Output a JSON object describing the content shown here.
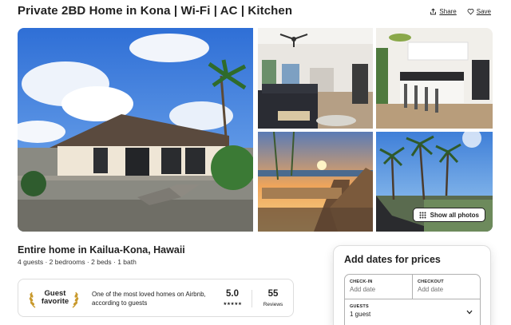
{
  "header": {
    "title": "Private 2BD Home in Kona | Wi-Fi | AC | Kitchen",
    "share_label": "Share",
    "save_label": "Save"
  },
  "gallery": {
    "show_all_label": "Show all photos",
    "photos": [
      "house-exterior",
      "living-room",
      "kitchen",
      "patio-sunset",
      "palm-lounge"
    ]
  },
  "listing": {
    "title": "Entire home in Kailua-Kona, Hawaii",
    "details": "4 guests · 2 bedrooms · 2 beds · 1 bath"
  },
  "favorite": {
    "badge_line1": "Guest",
    "badge_line2": "favorite",
    "description": "One of the most loved homes on Airbnb, according to guests",
    "rating": "5.0",
    "stars": "★★★★★",
    "review_count": "55",
    "reviews_label": "Reviews"
  },
  "booking": {
    "title": "Add dates for prices",
    "checkin_label": "CHECK-IN",
    "checkin_placeholder": "Add date",
    "checkout_label": "CHECKOUT",
    "checkout_placeholder": "Add date",
    "guests_label": "GUESTS",
    "guests_value": "1 guest"
  },
  "icons": {
    "share": "share-icon",
    "save": "heart-icon",
    "show_all": "grid-icon",
    "guests_dropdown": "chevron-down-icon"
  }
}
